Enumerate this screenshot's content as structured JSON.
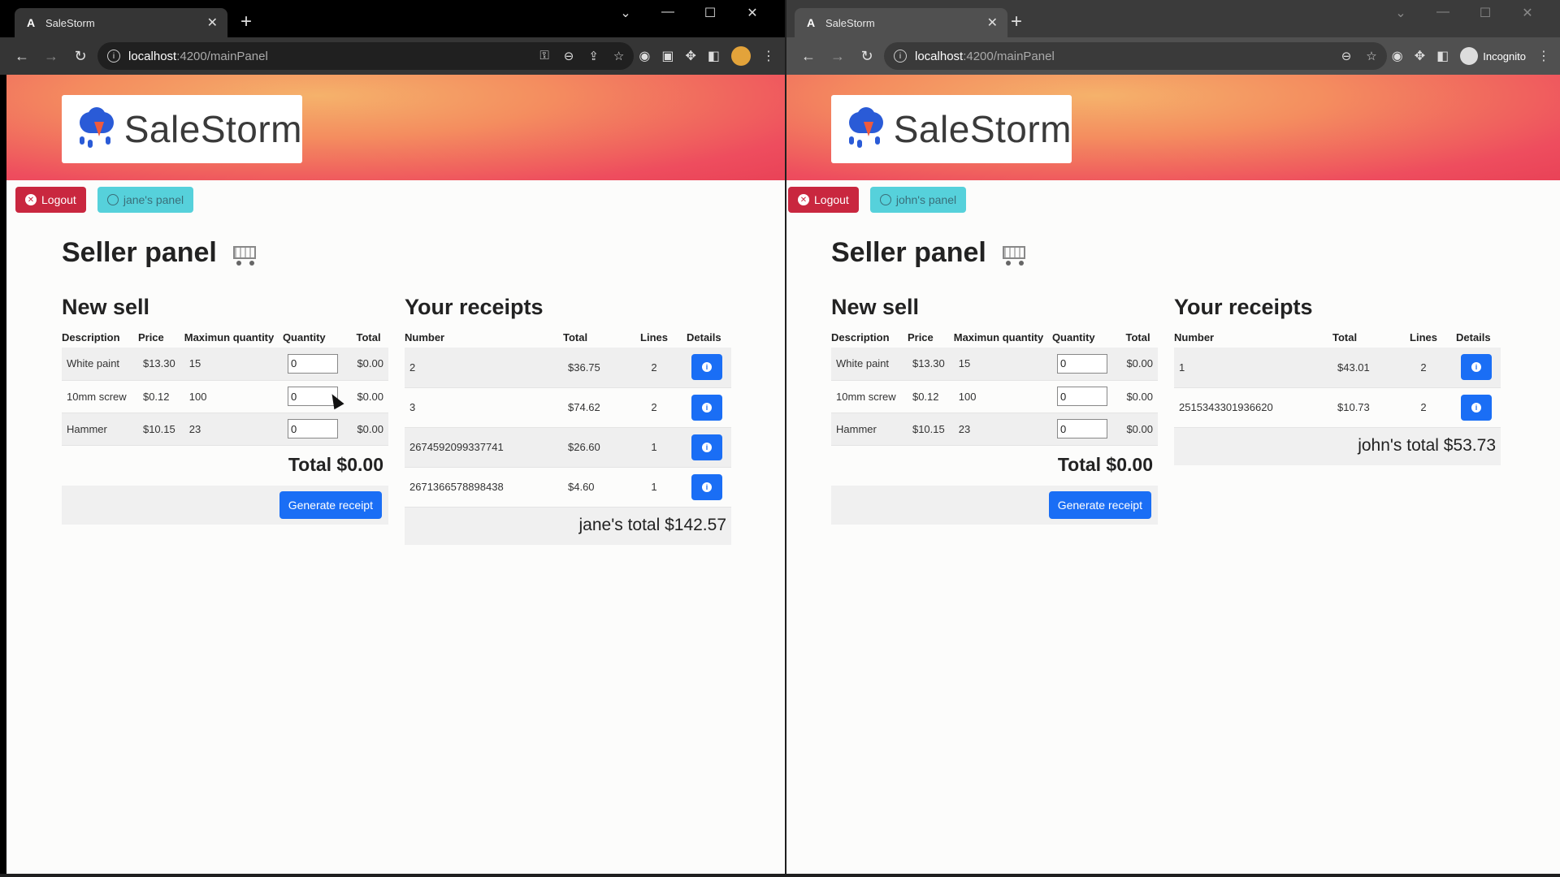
{
  "left_window": {
    "tab_title": "SaleStorm",
    "url_host": "localhost",
    "url_path": ":4200/mainPanel",
    "incognito": false,
    "app": {
      "brand": "SaleStorm",
      "logout_label": "Logout",
      "panel_label": "jane's panel",
      "page_title": "Seller panel",
      "new_sell_title": "New sell",
      "sell_headers": [
        "Description",
        "Price",
        "Maximun quantity",
        "Quantity",
        "Total"
      ],
      "products": [
        {
          "description": "White paint",
          "price": "$13.30",
          "max": "15",
          "quantity": "0",
          "total": "$0.00"
        },
        {
          "description": "10mm screw",
          "price": "$0.12",
          "max": "100",
          "quantity": "0",
          "total": "$0.00"
        },
        {
          "description": "Hammer",
          "price": "$10.15",
          "max": "23",
          "quantity": "0",
          "total": "$0.00"
        }
      ],
      "sell_total": "Total $0.00",
      "generate_label": "Generate receipt",
      "receipts_title": "Your receipts",
      "receipt_headers": [
        "Number",
        "Total",
        "Lines",
        "Details"
      ],
      "receipts": [
        {
          "number": "2",
          "total": "$36.75",
          "lines": "2"
        },
        {
          "number": "3",
          "total": "$74.62",
          "lines": "2"
        },
        {
          "number": "2674592099337741",
          "total": "$26.60",
          "lines": "1"
        },
        {
          "number": "2671366578898438",
          "total": "$4.60",
          "lines": "1"
        }
      ],
      "receipts_total": "jane's total $142.57"
    }
  },
  "right_window": {
    "tab_title": "SaleStorm",
    "url_host": "localhost",
    "url_path": ":4200/mainPanel",
    "incognito_label": "Incognito",
    "app": {
      "brand": "SaleStorm",
      "logout_label": "Logout",
      "panel_label": "john's panel",
      "page_title": "Seller panel",
      "new_sell_title": "New sell",
      "sell_headers": [
        "Description",
        "Price",
        "Maximun quantity",
        "Quantity",
        "Total"
      ],
      "products": [
        {
          "description": "White paint",
          "price": "$13.30",
          "max": "15",
          "quantity": "0",
          "total": "$0.00"
        },
        {
          "description": "10mm screw",
          "price": "$0.12",
          "max": "100",
          "quantity": "0",
          "total": "$0.00"
        },
        {
          "description": "Hammer",
          "price": "$10.15",
          "max": "23",
          "quantity": "0",
          "total": "$0.00"
        }
      ],
      "sell_total": "Total $0.00",
      "generate_label": "Generate receipt",
      "receipts_title": "Your receipts",
      "receipt_headers": [
        "Number",
        "Total",
        "Lines",
        "Details"
      ],
      "receipts": [
        {
          "number": "1",
          "total": "$43.01",
          "lines": "2"
        },
        {
          "number": "2515343301936620",
          "total": "$10.73",
          "lines": "2"
        }
      ],
      "receipts_total": "john's total $53.73"
    }
  },
  "colors": {
    "logout": "#c9273f",
    "panel": "#56d1db",
    "primary": "#1a6ef5"
  }
}
